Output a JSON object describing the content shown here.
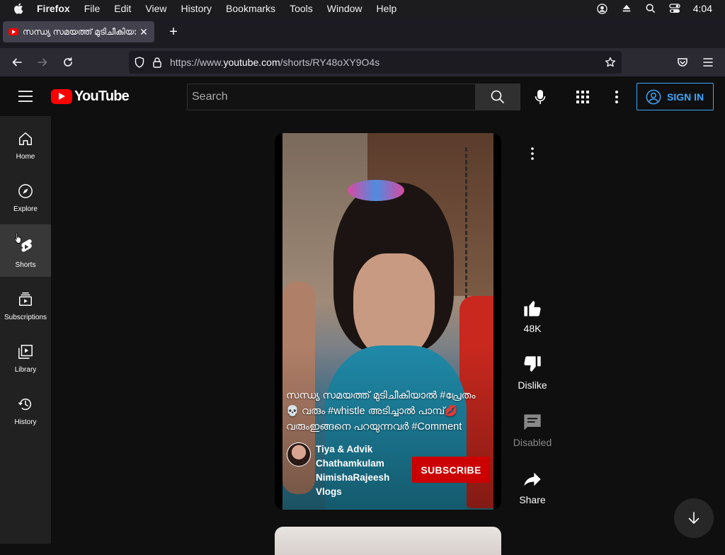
{
  "menubar": {
    "app": "Firefox",
    "items": [
      "File",
      "Edit",
      "View",
      "History",
      "Bookmarks",
      "Tools",
      "Window",
      "Help"
    ],
    "clock": "4:04"
  },
  "browser": {
    "tab_title": "സന്ധ്യ സമയത്ത് മുടിചീകിയാൽ #",
    "url_prefix": "https://www.",
    "url_domain": "youtube.com",
    "url_path": "/shorts/RY48oXY9O4s"
  },
  "youtube": {
    "logo_text": "YouTube",
    "search_placeholder": "Search",
    "sign_in_label": "SIGN IN",
    "sidebar": [
      {
        "label": "Home"
      },
      {
        "label": "Explore"
      },
      {
        "label": "Shorts"
      },
      {
        "label": "Subscriptions"
      },
      {
        "label": "Library"
      },
      {
        "label": "History"
      }
    ]
  },
  "short": {
    "caption": "സന്ധ്യ സമയത്ത് മുടിചീകിയാൽ #പ്രേതം 💀 വരും #whistle അടിച്ചാൽ പാമ്പ്💋 വരുംഇങ്ങനെ പറയുന്നവർ #Comment",
    "channel_name": "Tiya & Advik Chathamkulam NimishaRajeesh Vlogs",
    "subscribe_label": "SUBSCRIBE",
    "actions": {
      "like_count": "48K",
      "dislike_label": "Dislike",
      "comments_label": "Disabled",
      "share_label": "Share"
    }
  },
  "colors": {
    "accent_red": "#ff0000",
    "subscribe_red": "#cc0000",
    "signin_blue": "#3ea6ff",
    "background": "#0f0f0f",
    "sidebar": "#212121"
  }
}
